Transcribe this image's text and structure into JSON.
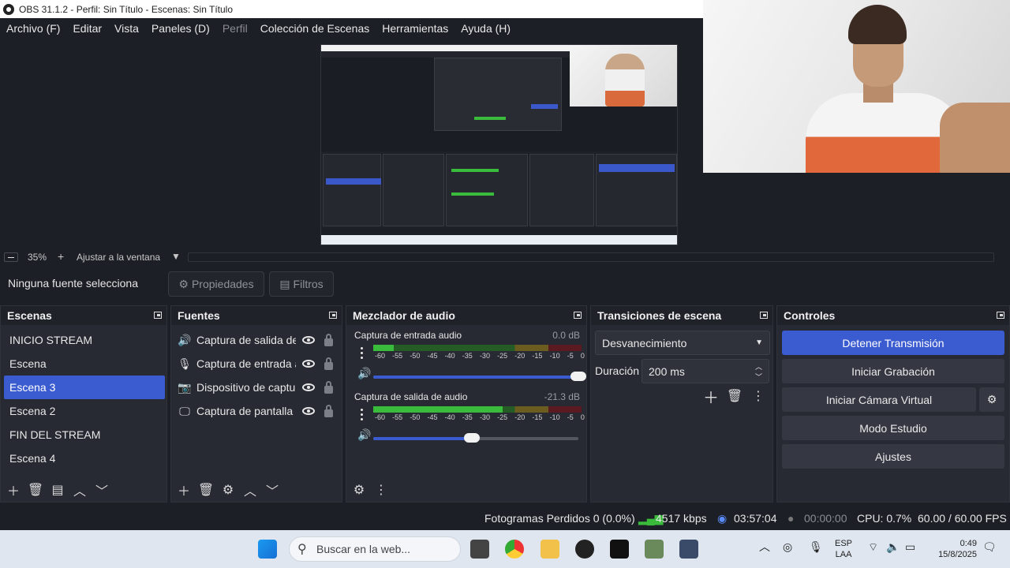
{
  "window": {
    "title": "OBS 31.1.2 - Perfil: Sin Título - Escenas: Sin Título"
  },
  "menu": [
    {
      "label": "Archivo (F)",
      "disabled": false
    },
    {
      "label": "Editar",
      "disabled": false
    },
    {
      "label": "Vista",
      "disabled": false
    },
    {
      "label": "Paneles (D)",
      "disabled": false
    },
    {
      "label": "Perfil",
      "disabled": true
    },
    {
      "label": "Colección de Escenas",
      "disabled": false
    },
    {
      "label": "Herramientas",
      "disabled": false
    },
    {
      "label": "Ayuda (H)",
      "disabled": false
    }
  ],
  "zoom": {
    "level": "35%",
    "fit_label": "Ajustar a la ventana"
  },
  "sourcebar": {
    "no_selection": "Ninguna fuente selecciona",
    "properties": "Propiedades",
    "filters": "Filtros"
  },
  "scenes": {
    "title": "Escenas",
    "items": [
      "INICIO STREAM",
      "Escena",
      "Escena 3",
      "Escena 2",
      "FIN DEL STREAM",
      "Escena 4"
    ],
    "selected_index": 2
  },
  "sources": {
    "title": "Fuentes",
    "items": [
      {
        "label": "Captura de salida de",
        "icon": "speaker-icon"
      },
      {
        "label": "Captura de entrada a",
        "icon": "microphone-icon"
      },
      {
        "label": "Dispositivo de captur",
        "icon": "camera-icon"
      },
      {
        "label": "Captura de pantalla",
        "icon": "monitor-icon"
      }
    ]
  },
  "mixer": {
    "title": "Mezclador de audio",
    "channels": [
      {
        "name": "Captura de entrada audio",
        "db": "0.0 dB",
        "level": 0.1,
        "volume": 1.0
      },
      {
        "name": "Captura de salida de audio",
        "db": "-21.3 dB",
        "level": 0.62,
        "volume": 0.48
      }
    ],
    "ticks": [
      "-60",
      "-55",
      "-50",
      "-45",
      "-40",
      "-35",
      "-30",
      "-25",
      "-20",
      "-15",
      "-10",
      "-5",
      "0"
    ]
  },
  "transitions": {
    "title": "Transiciones de escena",
    "selected": "Desvanecimiento",
    "duration_label": "Duración",
    "duration_value": "200 ms"
  },
  "controls": {
    "title": "Controles",
    "stop_stream": "Detener Transmisión",
    "start_recording": "Iniciar Grabación",
    "start_virtual_cam": "Iniciar Cámara Virtual",
    "studio_mode": "Modo Estudio",
    "settings": "Ajustes"
  },
  "status": {
    "dropped_frames": "Fotogramas Perdidos 0 (0.0%)",
    "bitrate": "4517 kbps",
    "stream_time": "03:57:04",
    "record_time": "00:00:00",
    "cpu": "CPU: 0.7%",
    "fps": "60.00 / 60.00 FPS"
  },
  "taskbar": {
    "search_placeholder": "Buscar en la web...",
    "lang_top": "ESP",
    "lang_bottom": "LAA",
    "time": "0:49",
    "date": "15/8/2025"
  },
  "colors": {
    "accent": "#3b5bd0",
    "background": "#1d1f26",
    "panel": "#272a33"
  }
}
